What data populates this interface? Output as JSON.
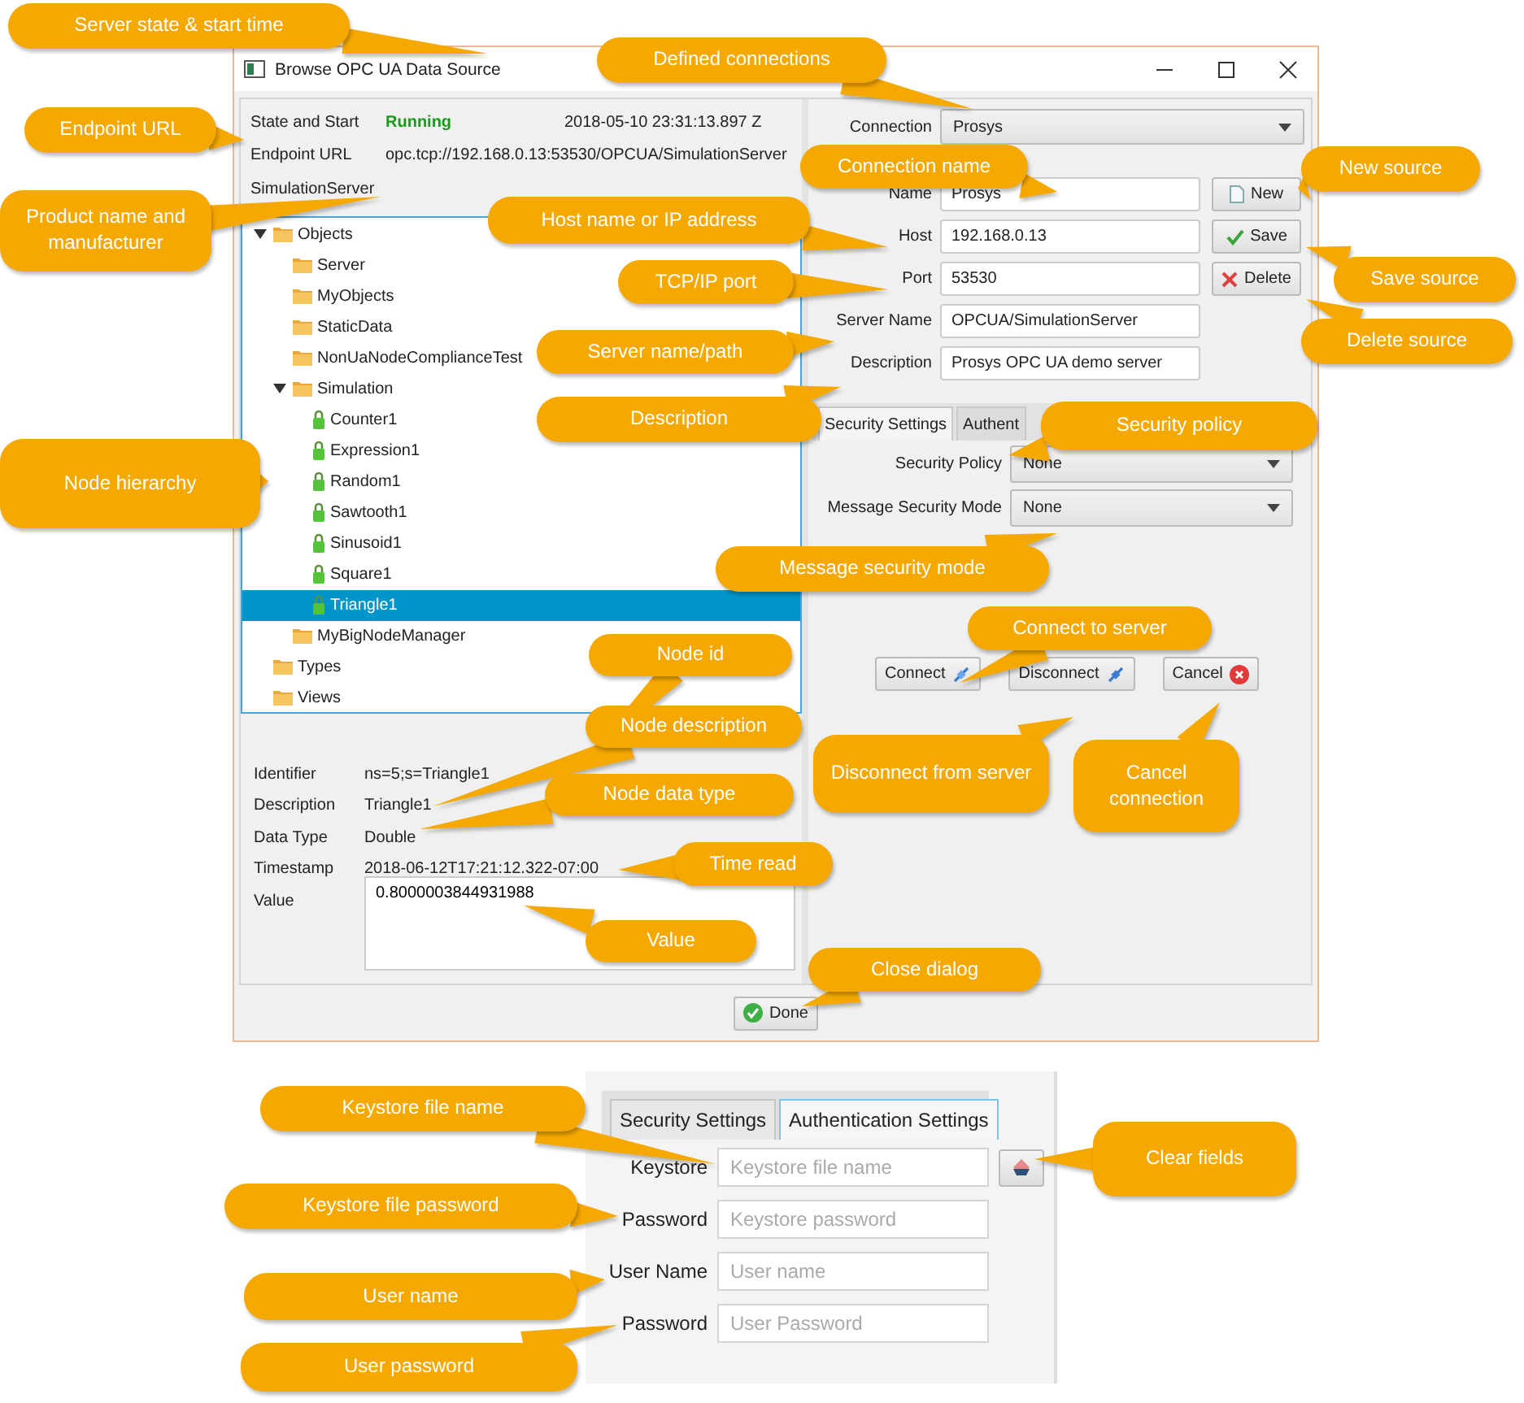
{
  "window": {
    "title": "Browse OPC UA Data Source"
  },
  "server_info": {
    "state_label": "State and Start",
    "state": "Running",
    "start_time": "2018-05-10 23:31:13.897 Z",
    "endpoint_label": "Endpoint URL",
    "endpoint": "opc.tcp://192.168.0.13:53530/OPCUA/SimulationServer",
    "product": "SimulationServer"
  },
  "tree": [
    {
      "label": "Objects",
      "kind": "folder",
      "expanded": true,
      "selected": false,
      "children": [
        {
          "label": "Server",
          "kind": "folder",
          "selected": false
        },
        {
          "label": "MyObjects",
          "kind": "folder",
          "selected": false
        },
        {
          "label": "StaticData",
          "kind": "folder",
          "selected": false
        },
        {
          "label": "NonUaNodeComplianceTest",
          "kind": "folder",
          "selected": false
        },
        {
          "label": "Simulation",
          "kind": "folder",
          "expanded": true,
          "selected": false,
          "children": [
            {
              "label": "Counter1",
              "kind": "variable",
              "selected": false
            },
            {
              "label": "Expression1",
              "kind": "variable",
              "selected": false
            },
            {
              "label": "Random1",
              "kind": "variable",
              "selected": false
            },
            {
              "label": "Sawtooth1",
              "kind": "variable",
              "selected": false
            },
            {
              "label": "Sinusoid1",
              "kind": "variable",
              "selected": false
            },
            {
              "label": "Square1",
              "kind": "variable",
              "selected": false
            },
            {
              "label": "Triangle1",
              "kind": "variable",
              "selected": true
            }
          ]
        },
        {
          "label": "MyBigNodeManager",
          "kind": "folder",
          "selected": false
        }
      ]
    },
    {
      "label": "Types",
      "kind": "folder",
      "selected": false
    },
    {
      "label": "Views",
      "kind": "folder",
      "selected": false
    }
  ],
  "details": [
    {
      "label": "Identifier",
      "value": "ns=5;s=Triangle1",
      "kind": "text"
    },
    {
      "label": "Description",
      "value": "Triangle1",
      "kind": "text"
    },
    {
      "label": "Data Type",
      "value": "Double",
      "kind": "text"
    },
    {
      "label": "Timestamp",
      "value": "2018-06-12T17:21:12.322-07:00",
      "kind": "text"
    },
    {
      "label": "Value",
      "value": "0.8000003844931988",
      "kind": "textarea"
    }
  ],
  "connection": {
    "label": "Connection",
    "value": "Prosys"
  },
  "fields": [
    {
      "label": "Name",
      "value": "Prosys"
    },
    {
      "label": "Host",
      "value": "192.168.0.13"
    },
    {
      "label": "Port",
      "value": "53530"
    },
    {
      "label": "Server Name",
      "value": "OPCUA/SimulationServer"
    },
    {
      "label": "Description",
      "value": "Prosys OPC UA demo server"
    }
  ],
  "source_buttons": [
    {
      "label": "New",
      "kind": "new"
    },
    {
      "label": "Save",
      "kind": "save"
    },
    {
      "label": "Delete",
      "kind": "delete"
    }
  ],
  "tabs": [
    {
      "label": "Security Settings",
      "selected": true
    },
    {
      "label": "Authent",
      "selected": false
    }
  ],
  "security": [
    {
      "label": "Security Policy",
      "value": "None"
    },
    {
      "label": "Message Security Mode",
      "value": "None"
    }
  ],
  "connect_buttons": [
    {
      "label": "Connect",
      "kind": "connect"
    },
    {
      "label": "Disconnect",
      "kind": "disconnect"
    },
    {
      "label": "Cancel",
      "kind": "cancel"
    }
  ],
  "done_button": "Done",
  "auth_panel": {
    "tabs": [
      {
        "label": "Security Settings",
        "selected": false
      },
      {
        "label": "Authentication Settings",
        "selected": true
      }
    ],
    "fields": [
      {
        "label": "Keystore",
        "placeholder": "Keystore file name"
      },
      {
        "label": "Password",
        "placeholder": "Keystore password"
      },
      {
        "label": "User Name",
        "placeholder": "User name"
      },
      {
        "label": "Password",
        "placeholder": "User Password"
      }
    ]
  },
  "callouts": [
    {
      "text": "Server state & start time"
    },
    {
      "text": "Defined connections"
    },
    {
      "text": "Endpoint URL"
    },
    {
      "text": "Product name and manufacturer"
    },
    {
      "text": "Connection name"
    },
    {
      "text": "New source"
    },
    {
      "text": "Host name or IP address"
    },
    {
      "text": "Save source"
    },
    {
      "text": "TCP/IP port"
    },
    {
      "text": "Delete source"
    },
    {
      "text": "Server name/path"
    },
    {
      "text": "Description"
    },
    {
      "text": "Security policy"
    },
    {
      "text": "Node hierarchy"
    },
    {
      "text": "Message security mode"
    },
    {
      "text": "Connect to server"
    },
    {
      "text": "Node id"
    },
    {
      "text": "Node description"
    },
    {
      "text": "Node data type"
    },
    {
      "text": "Disconnect from server"
    },
    {
      "text": "Cancel connection"
    },
    {
      "text": "Time read"
    },
    {
      "text": "Value"
    },
    {
      "text": "Close dialog"
    },
    {
      "text": "Keystore file name"
    },
    {
      "text": "Clear fields"
    },
    {
      "text": "Keystore file password"
    },
    {
      "text": "User name"
    },
    {
      "text": "User password"
    }
  ]
}
